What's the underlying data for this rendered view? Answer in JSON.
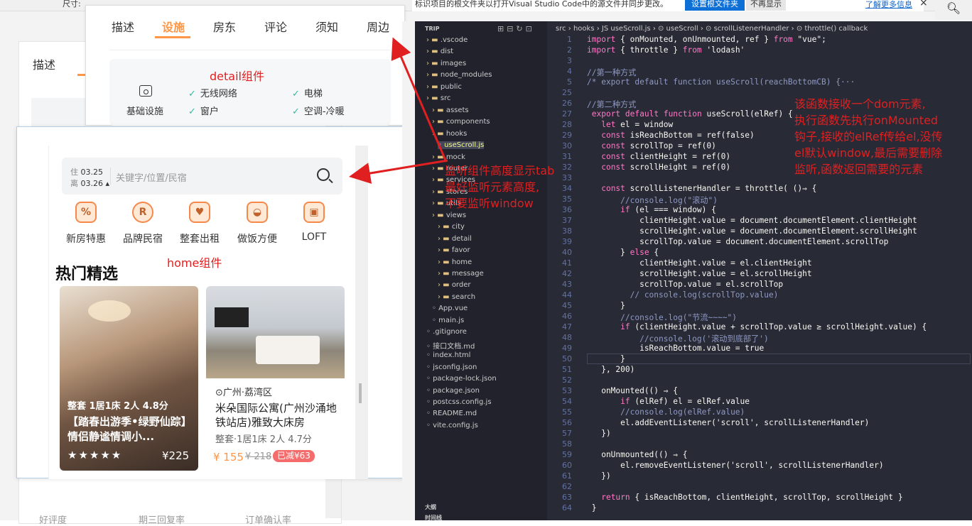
{
  "browser_bar": {
    "left_text": "尺寸:",
    "notice": "标识项目的根文件夹以打开Visual Studio Code中的源文件并同步更改。",
    "set_root_btn": "设置根文件夹",
    "dismiss_btn": "不再显示",
    "learn_more": "了解更多信息",
    "close": "×"
  },
  "back_page": {
    "tab": "描述",
    "bottom": [
      "好评度",
      "期三回复率",
      "订单确认率"
    ]
  },
  "detail": {
    "component_label": "detail组件",
    "tabs": [
      "描述",
      "设施",
      "房东",
      "评论",
      "须知",
      "周边"
    ],
    "active_tab": "设施",
    "facility_label": "基础设施",
    "items": [
      "无线网络",
      "电梯",
      "窗户",
      "空调-冷暖"
    ]
  },
  "home": {
    "component_label": "home组件",
    "search": {
      "checkin_label": "住",
      "checkin": "03.25",
      "checkout_label": "离",
      "checkout": "03.26",
      "placeholder": "关键字/位置/民宿"
    },
    "categories": [
      {
        "label": "新房特惠",
        "icon": "new-house-icon",
        "glyph": "%"
      },
      {
        "label": "品牌民宿",
        "icon": "brand-icon",
        "glyph": "R"
      },
      {
        "label": "整套出租",
        "icon": "whole-rent-icon",
        "glyph": "♥"
      },
      {
        "label": "做饭方便",
        "icon": "cooking-icon",
        "glyph": "◒"
      },
      {
        "label": "LOFT",
        "icon": "loft-icon",
        "glyph": "▣"
      }
    ],
    "section_title": "热门精选",
    "card1": {
      "tag": "整套 1居1床 2人 4.8分",
      "title": "【踏春出游季•绿野仙踪】情侣静谧情调小...",
      "stars": "★★★★★",
      "price": "¥225"
    },
    "card2": {
      "location": "广州·荔湾区",
      "title": "米朵国际公寓(广州沙涌地铁站店)雅致大床房",
      "tag": "整套·1居1床 2人 4.7分",
      "price": "¥ 155",
      "old_price": "¥ 218",
      "discount": "已减¥63"
    }
  },
  "annotations": {
    "left": [
      "监听组件高度显示tab",
      "最好监听元素高度,",
      "不要监听window"
    ],
    "right": [
      "该函数接收一个dom元素,",
      "执行函数先执行onMounted",
      "钩子,接收的elRef传给el,没传",
      "el默认window,最后需要删除",
      "监听,函数返回需要的元素"
    ]
  },
  "vscode": {
    "breadcrumb": "src › hooks › JS useScroll.js › ⊙ useScroll › ⊙ scrollListenerHandler › ⊙ throttle() callback",
    "explorer_title": "TRIP",
    "tree": [
      {
        "name": ".vscode",
        "kind": "folder"
      },
      {
        "name": "dist",
        "kind": "folder"
      },
      {
        "name": "images",
        "kind": "folder"
      },
      {
        "name": "node_modules",
        "kind": "folder"
      },
      {
        "name": "public",
        "kind": "folder"
      },
      {
        "name": "src",
        "kind": "folder"
      },
      {
        "name": "assets",
        "kind": "folder"
      },
      {
        "name": "components",
        "kind": "folder"
      },
      {
        "name": "hooks",
        "kind": "folder"
      },
      {
        "name": "useScroll.js",
        "kind": "file"
      },
      {
        "name": "mock",
        "kind": "folder"
      },
      {
        "name": "router",
        "kind": "folder"
      },
      {
        "name": "services",
        "kind": "folder"
      },
      {
        "name": "stores",
        "kind": "folder"
      },
      {
        "name": "utils",
        "kind": "folder"
      },
      {
        "name": "views",
        "kind": "folder"
      },
      {
        "name": "city",
        "kind": "folder"
      },
      {
        "name": "detail",
        "kind": "folder"
      },
      {
        "name": "favor",
        "kind": "folder"
      },
      {
        "name": "home",
        "kind": "folder"
      },
      {
        "name": "message",
        "kind": "folder"
      },
      {
        "name": "order",
        "kind": "folder"
      },
      {
        "name": "search",
        "kind": "folder"
      },
      {
        "name": "App.vue",
        "kind": "file"
      },
      {
        "name": "main.js",
        "kind": "file"
      },
      {
        "name": ".gitignore",
        "kind": "file"
      },
      {
        "name": "接口文档.md",
        "kind": "file"
      },
      {
        "name": "index.html",
        "kind": "file"
      },
      {
        "name": "jsconfig.json",
        "kind": "file"
      },
      {
        "name": "package-lock.json",
        "kind": "file"
      },
      {
        "name": "package.json",
        "kind": "file"
      },
      {
        "name": "postcss.config.js",
        "kind": "file"
      },
      {
        "name": "README.md",
        "kind": "file"
      },
      {
        "name": "vite.config.js",
        "kind": "file"
      }
    ],
    "outline": "大纲",
    "timeline": "时间线",
    "line_numbers": [
      "1",
      "2",
      "3",
      "4",
      "5",
      "25",
      "26",
      "27",
      "28",
      "29",
      "30",
      "31",
      "32",
      "33",
      "34",
      "35",
      "36",
      "37",
      "38",
      "39",
      "40",
      "41",
      "42",
      "43",
      "44",
      "45",
      "46",
      "47",
      "48",
      "49",
      "50",
      "51",
      "52",
      "53",
      "54",
      "55",
      "56",
      "57",
      "58",
      "59",
      "60",
      "61",
      "62",
      "63",
      "64"
    ],
    "code": [
      "import { onMounted, onUnmounted, ref } from \"vue\";",
      "import { throttle } from 'lodash'",
      "",
      "//第一种方式",
      "/* export default function useScroll(reachBottomCB) {···",
      "",
      "//第二种方式",
      " export default function useScroll(elRef) {",
      "   let el = window",
      "   const isReachBottom = ref(false)",
      "   const scrollTop = ref(0)",
      "   const clientHeight = ref(0)",
      "   const scrollHeight = ref(0)",
      "",
      "   const scrollListenerHandler = throttle( ()⇒ {",
      "       //console.log(\"滚动\")",
      "       if (el === window) {",
      "           clientHeight.value = document.documentElement.clientHeight",
      "           scrollHeight.value = document.documentElement.scrollHeight",
      "           scrollTop.value = document.documentElement.scrollTop",
      "       } else {",
      "           clientHeight.value = el.clientHeight",
      "           scrollHeight.value = el.scrollHeight",
      "           scrollTop.value = el.scrollTop",
      "         // console.log(scrollTop.value)",
      "       }",
      "       //console.log(\"节流~~~~\")",
      "       if (clientHeight.value + scrollTop.value ≥ scrollHeight.value) {",
      "           //console.log('滚动到底部了')",
      "           isReachBottom.value = true",
      "       }",
      "   }, 200)",
      "",
      "   onMounted(() ⇒ {",
      "       if (elRef) el = elRef.value",
      "       //console.log(elRef.value)",
      "       el.addEventListener('scroll', scrollListenerHandler)",
      "   })",
      "",
      "   onUnmounted(() ⇒ {",
      "       el.removeEventListener('scroll', scrollListenerHandler)",
      "   })",
      "",
      "   return { isReachBottom, clientHeight, scrollTop, scrollHeight }",
      " }"
    ]
  }
}
